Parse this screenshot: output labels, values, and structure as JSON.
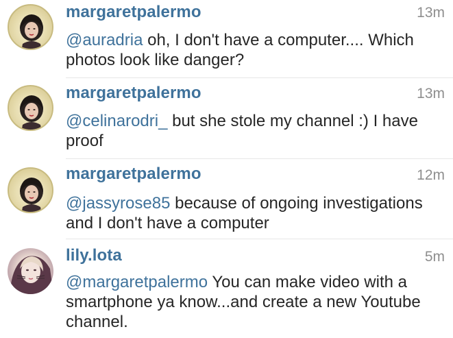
{
  "comments": [
    {
      "username": "margaretpalermo",
      "time": "13m",
      "mention": "@auradria",
      "text": " oh, I don't have a computer.... Which photos look like danger?"
    },
    {
      "username": "margaretpalermo",
      "time": "13m",
      "mention": "@celinarodri_",
      "text": " but she stole my channel :) I have proof"
    },
    {
      "username": "margaretpalermo",
      "time": "12m",
      "mention": "@jassyrose85",
      "text": " because of ongoing investigations and I don't have a computer"
    },
    {
      "username": "lily.lota",
      "time": "5m",
      "mention": "@margaretpalermo",
      "text": " You can make video with a smartphone ya know...and create a new Youtube channel."
    }
  ],
  "colors": {
    "link": "#3f729b",
    "text": "#262626",
    "timestamp": "#8e8e8e",
    "divider": "#e6e6e6"
  }
}
